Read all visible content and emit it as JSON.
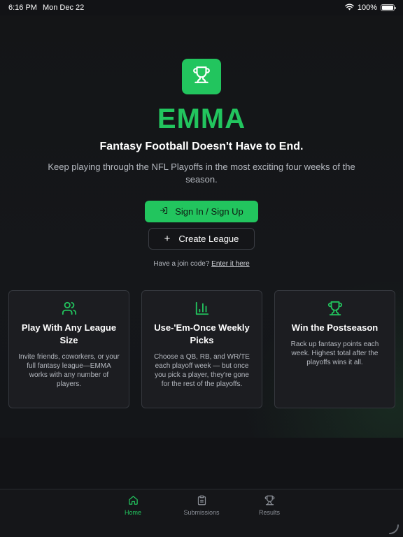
{
  "status_bar": {
    "time": "6:16 PM",
    "date": "Mon Dec 22",
    "battery": "100%",
    "battery_level": 1.0,
    "wifi_icon": "wifi-icon",
    "battery_icon": "battery-icon"
  },
  "hero": {
    "logo_icon": "trophy-icon",
    "title": "EMMA",
    "headline": "Fantasy Football Doesn't Have to End.",
    "subhead": "Keep playing through the NFL Playoffs in the most exciting four weeks of the season."
  },
  "actions": {
    "sign_in_label": "Sign In / Sign Up",
    "sign_in_icon": "log-in-icon",
    "create_league_label": "Create League",
    "create_league_icon": "plus-icon",
    "join_prompt": "Have a join code?",
    "join_link": "Enter it here"
  },
  "features": [
    {
      "icon": "users-icon",
      "title": "Play With Any League Size",
      "body": "Invite friends, coworkers, or your full fantasy league—EMMA works with any number of players."
    },
    {
      "icon": "bar-chart-icon",
      "title": "Use-'Em-Once Weekly Picks",
      "body": "Choose a QB, RB, and WR/TE each playoff week — but once you pick a player, they're gone for the rest of the playoffs."
    },
    {
      "icon": "trophy-icon",
      "title": "Win the Postseason",
      "body": "Rack up fantasy points each week. Highest total after the playoffs wins it all."
    }
  ],
  "tabs": [
    {
      "label": "Home",
      "icon": "home-icon",
      "active": true
    },
    {
      "label": "Submissions",
      "icon": "clipboard-icon",
      "active": false
    },
    {
      "label": "Results",
      "icon": "trophy-icon",
      "active": false
    }
  ],
  "colors": {
    "accent": "#22c55e",
    "background": "#121316",
    "card": "#1c1d21",
    "muted_text": "#b5b9c0"
  }
}
